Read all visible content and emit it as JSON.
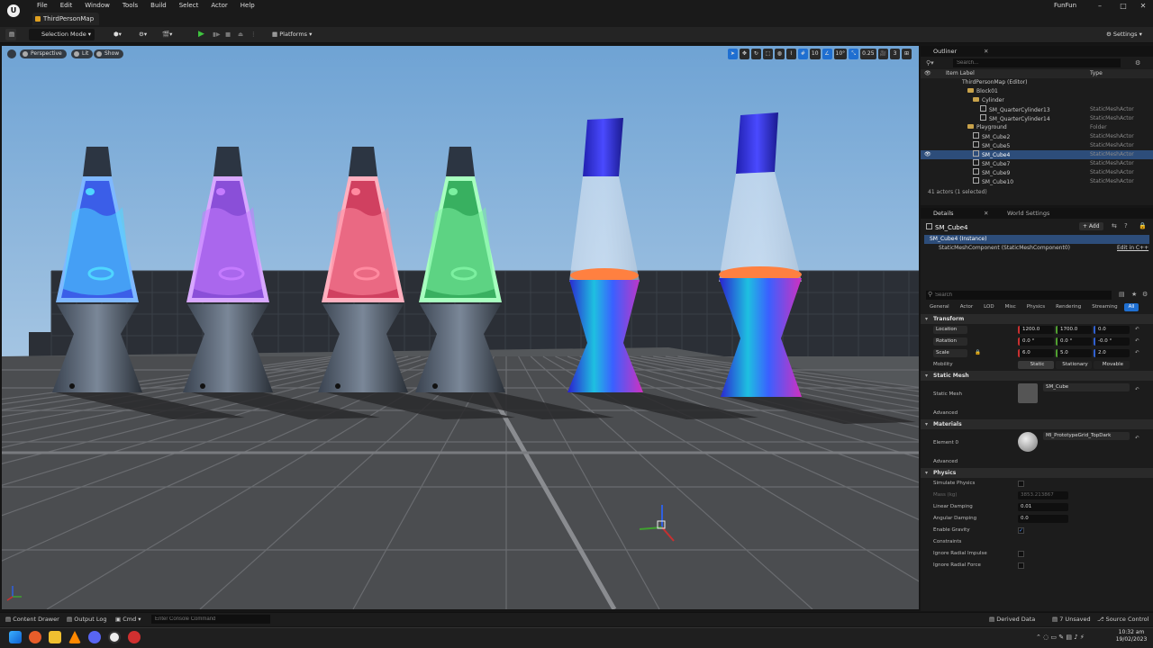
{
  "app": {
    "menu": [
      "File",
      "Edit",
      "Window",
      "Tools",
      "Build",
      "Select",
      "Actor",
      "Help"
    ],
    "tab": "ThirdPersonMap",
    "project": "FunFun"
  },
  "toolbar": {
    "selection_mode": "Selection Mode",
    "platforms": "Platforms",
    "settings": "Settings"
  },
  "viewport": {
    "perspective": "Perspective",
    "lit": "Lit",
    "show": "Show",
    "grid_snap": "10",
    "rot_snap": "10°",
    "scale_snap": "0.25",
    "cam_speed": "3"
  },
  "outliner": {
    "title": "Outliner",
    "search_placeholder": "Search...",
    "col_label": "Item Label",
    "col_type": "Type",
    "rows": [
      {
        "label": "ThirdPersonMap (Editor)",
        "type": "",
        "kind": "map"
      },
      {
        "label": "Block01",
        "type": "",
        "kind": "folder"
      },
      {
        "label": "Cylinder",
        "type": "",
        "kind": "folder"
      },
      {
        "label": "SM_QuarterCylinder13",
        "type": "StaticMeshActor",
        "kind": "mesh"
      },
      {
        "label": "SM_QuarterCylinder14",
        "type": "StaticMeshActor",
        "kind": "mesh"
      },
      {
        "label": "Playground",
        "type": "Folder",
        "kind": "folder"
      },
      {
        "label": "SM_Cube2",
        "type": "StaticMeshActor",
        "kind": "mesh"
      },
      {
        "label": "SM_Cube5",
        "type": "StaticMeshActor",
        "kind": "mesh"
      },
      {
        "label": "SM_Cube4",
        "type": "StaticMeshActor",
        "kind": "mesh"
      },
      {
        "label": "SM_Cube7",
        "type": "StaticMeshActor",
        "kind": "mesh"
      },
      {
        "label": "SM_Cube9",
        "type": "StaticMeshActor",
        "kind": "mesh"
      },
      {
        "label": "SM_Cube10",
        "type": "StaticMeshActor",
        "kind": "mesh"
      }
    ],
    "selected_index": 8,
    "count": "41 actors (1 selected)"
  },
  "details": {
    "tab": "Details",
    "tab2": "World Settings",
    "actor": "SM_Cube4",
    "add": "+ Add",
    "instance": "SM_Cube4 (Instance)",
    "component": "StaticMeshComponent (StaticMeshComponent0)",
    "edit_cpp": "Edit in C++",
    "search_placeholder": "Search",
    "categories": [
      "General",
      "Actor",
      "LOD",
      "Misc",
      "Physics",
      "Rendering",
      "Streaming",
      "All"
    ],
    "transform": "Transform",
    "location_label": "Location",
    "location": [
      "1200.0",
      "1700.0",
      "0.0"
    ],
    "rotation_label": "Rotation",
    "rotation": [
      "0.0 °",
      "0.0 °",
      "-0.0 °"
    ],
    "scale_label": "Scale",
    "scale": [
      "6.0",
      "5.0",
      "2.0"
    ],
    "mobility_label": "Mobility",
    "mobility": [
      "Static",
      "Stationary",
      "Movable"
    ],
    "static_mesh_sec": "Static Mesh",
    "static_mesh_label": "Static Mesh",
    "static_mesh_value": "SM_Cube",
    "advanced": "Advanced",
    "materials_sec": "Materials",
    "element0_label": "Element 0",
    "element0_value": "MI_PrototypeGrid_TopDark",
    "physics_sec": "Physics",
    "simulate_physics": "Simulate Physics",
    "mass_kg": "Mass (kg)",
    "mass_value": "3853.213867",
    "linear_damping": "Linear Damping",
    "linear_damping_value": "0.01",
    "angular_damping": "Angular Damping",
    "angular_damping_value": "0.0",
    "enable_gravity": "Enable Gravity",
    "constraints": "Constraints",
    "ignore_radial_impulse": "Ignore Radial Impulse",
    "ignore_radial_force": "Ignore Radial Force"
  },
  "status": {
    "content_drawer": "Content Drawer",
    "output_log": "Output Log",
    "cmd": "Cmd",
    "console_placeholder": "Enter Console Command",
    "derived_data": "Derived Data",
    "unsaved": "7 Unsaved",
    "source_control": "Source Control"
  },
  "taskbar": {
    "time": "10:32 am",
    "date": "19/02/2023"
  },
  "lamps": [
    {
      "glass": "#3b5ee8",
      "wax": "#4fd6ff",
      "glow": "#7fb8ff"
    },
    {
      "glass": "#8a4fd8",
      "wax": "#c57bff",
      "glow": "#d8a8ff"
    },
    {
      "glass": "#d04060",
      "wax": "#ff8aa0",
      "glow": "#ffb0bf"
    },
    {
      "glass": "#38b060",
      "wax": "#7cf0a0",
      "glow": "#a8ffc0"
    }
  ]
}
